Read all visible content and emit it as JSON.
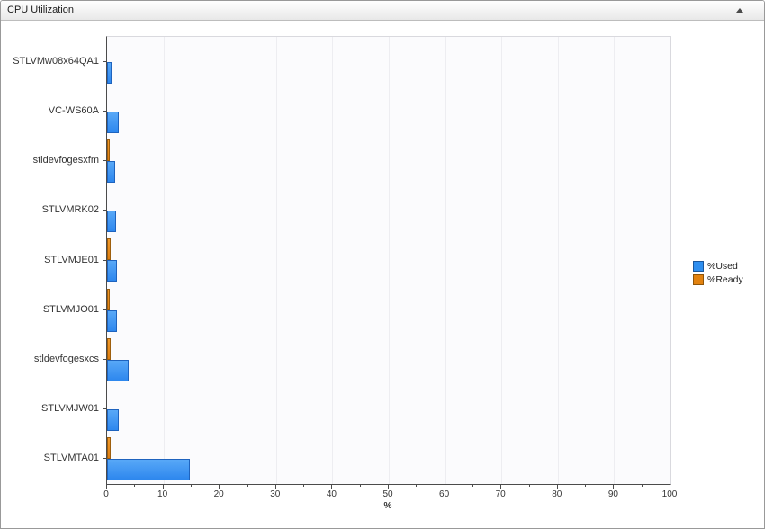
{
  "panel": {
    "title": "CPU Utilization",
    "collapse_icon": "up-triangle"
  },
  "chart_data": {
    "type": "bar",
    "orientation": "horizontal",
    "title": "CPU Utilization",
    "categories": [
      "STLVMw08x64QA1",
      "VC-WS60A",
      "stldevfogesxfm",
      "STLVMRK02",
      "STLVMJE01",
      "STLVMJO01",
      "stldevfogesxcs",
      "STLVMJW01",
      "STLVMTA01"
    ],
    "series": [
      {
        "name": "%Used",
        "color": "#2e8eef",
        "values": [
          0.4,
          1.7,
          1.1,
          1.2,
          1.4,
          1.45,
          3.5,
          1.8,
          14.4
        ]
      },
      {
        "name": "%Ready",
        "color": "#e2820f",
        "values": [
          0.05,
          0.05,
          0.2,
          0.05,
          0.25,
          0.15,
          0.3,
          0.05,
          0.3
        ]
      }
    ],
    "xlabel": "%",
    "xlim": [
      0,
      100
    ],
    "x_major_ticks": [
      0,
      10,
      20,
      30,
      40,
      50,
      60,
      70,
      80,
      90,
      100
    ],
    "x_minor_step": 5,
    "grid": "vertical major gridlines",
    "legend_position": "right",
    "bar_order_top_to_bottom": [
      "%Ready",
      "%Used"
    ]
  },
  "colors": {
    "bar_used_fill": "#2e8eef",
    "bar_used_border": "#1e63be",
    "bar_ready_fill": "#e2820f",
    "bar_ready_border": "#9d5e0d",
    "axis_line": "#4b4b4b",
    "gridline": "#ededf1",
    "plot_background": "#fbfbfd",
    "plot_border": "#d9d9de",
    "titlebar_gradient_end": "#e8e8e8"
  }
}
